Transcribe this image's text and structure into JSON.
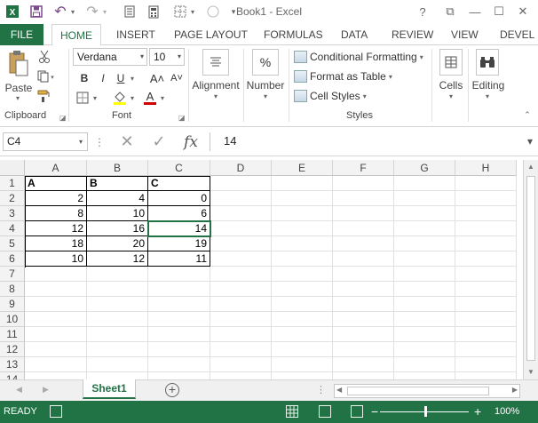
{
  "window": {
    "title": "Book1 - Excel",
    "help": "?",
    "restore_ribbon": "⧉",
    "minimize": "—",
    "maximize": "☐",
    "close": "✕"
  },
  "quick_access": {
    "undo": "↶",
    "redo": "↷",
    "more": "▾"
  },
  "tabs": [
    "FILE",
    "HOME",
    "INSERT",
    "PAGE LAYOUT",
    "FORMULAS",
    "DATA",
    "REVIEW",
    "VIEW",
    "DEVEL"
  ],
  "active_tab": "HOME",
  "ribbon": {
    "clipboard": {
      "label": "Clipboard",
      "paste_label": "Paste"
    },
    "font": {
      "label": "Font",
      "font_name": "Verdana",
      "font_size": "10",
      "bold": "B",
      "italic": "I",
      "underline": "U",
      "grow": "A˄",
      "shrink": "A˅",
      "font_color_letter": "A",
      "font_color": "#d00000"
    },
    "alignment": {
      "label": "Alignment"
    },
    "number": {
      "label": "Number",
      "symbol": "%"
    },
    "styles": {
      "label": "Styles",
      "conditional_formatting": "Conditional Formatting",
      "format_as_table": "Format as Table",
      "cell_styles": "Cell Styles"
    },
    "cells": {
      "label": "Cells"
    },
    "editing": {
      "label": "Editing"
    }
  },
  "formula_bar": {
    "name_box": "C4",
    "cancel": "✕",
    "enter": "✓",
    "fx": "fx",
    "value": "14"
  },
  "grid": {
    "columns": [
      "A",
      "B",
      "C",
      "D",
      "E",
      "F",
      "G",
      "H"
    ],
    "rows": [
      "1",
      "2",
      "3",
      "4",
      "5",
      "6",
      "7",
      "8",
      "9",
      "10",
      "11",
      "12",
      "13",
      "14"
    ],
    "data": [
      [
        "A",
        "B",
        "C"
      ],
      [
        "2",
        "4",
        "0"
      ],
      [
        "8",
        "10",
        "6"
      ],
      [
        "12",
        "16",
        "14"
      ],
      [
        "18",
        "20",
        "19"
      ],
      [
        "10",
        "12",
        "11"
      ]
    ],
    "active_cell": "C4"
  },
  "sheets": {
    "tabs": [
      "Sheet1"
    ],
    "active": "Sheet1",
    "add": "+"
  },
  "status": {
    "mode": "READY",
    "zoom_minus": "−",
    "zoom_plus": "+",
    "zoom": "100%"
  },
  "colors": {
    "accent": "#217346",
    "header_bg": "#f3f3f3",
    "gridline": "#e1e1e1"
  }
}
